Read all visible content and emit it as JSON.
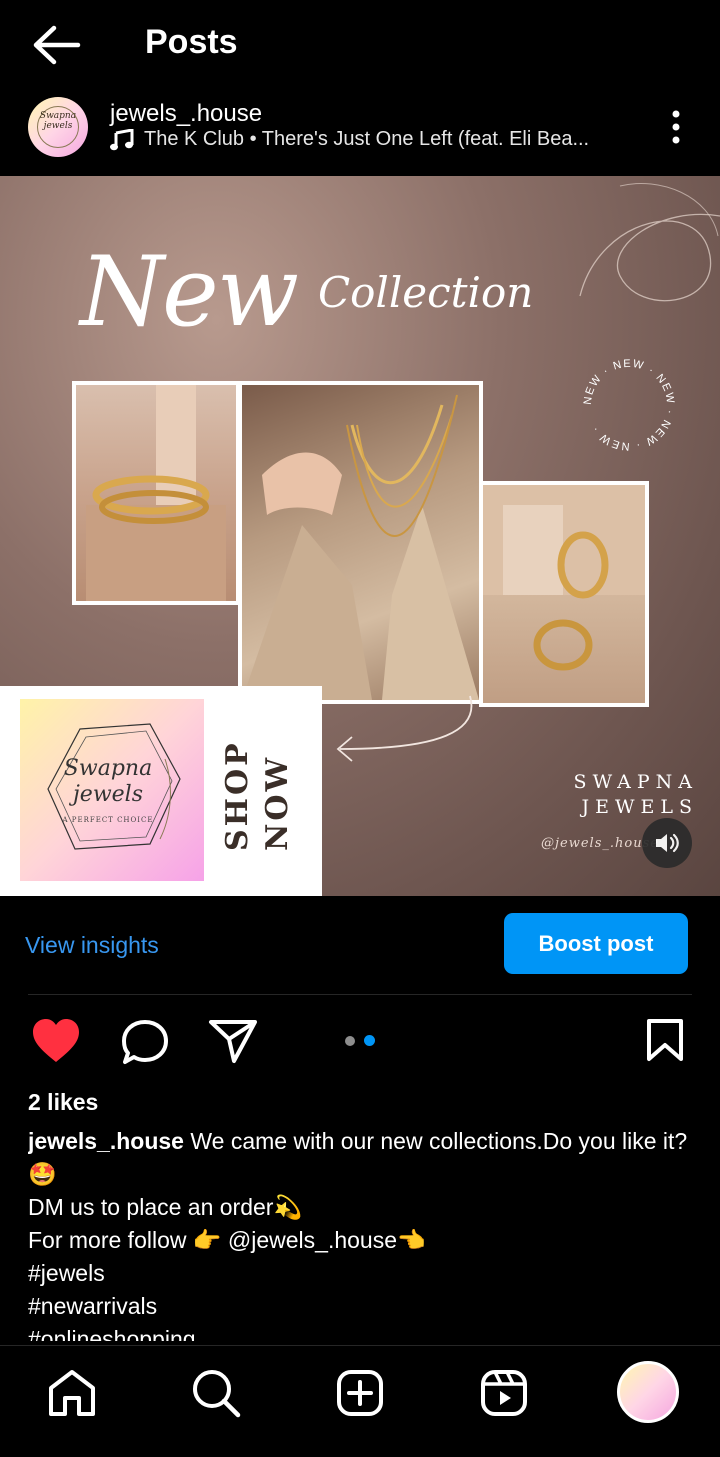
{
  "header": {
    "title": "Posts"
  },
  "post": {
    "username": "jewels_.house",
    "audio": "The K Club • There's Just One Left (feat. Eli Bea...",
    "avatar_text": "Swapna jewels",
    "image": {
      "headline": "New",
      "subheadline": "Collection",
      "badge_text": "NEW · NEW · NEW · NEW · NEW ·",
      "logo_script": "Swapna jewels",
      "logo_tagline": "A PERFECT CHOICE",
      "shop_now": "SHOP NOW",
      "brand_line1": "SWAPNA",
      "brand_line2": "JEWELS",
      "brand_handle": "@jewels_.house"
    }
  },
  "insights": {
    "view_label": "View insights",
    "boost_label": "Boost post"
  },
  "carousel": {
    "current": 2,
    "total": 2
  },
  "likes": "2 likes",
  "caption": {
    "user": "jewels_.house",
    "line1": " We came with our new collections.Do you like it?🤩",
    "line2": "DM us to place an order💫",
    "line3": "For more follow 👉 @jewels_.house👈",
    "line4": "#jewels",
    "line5": "#newarrivals",
    "line6": "#onlineshopping"
  },
  "colors": {
    "accent": "#0095f6",
    "link": "#3897f0",
    "like": "#ff3040",
    "background": "#000000"
  },
  "icons": {
    "back": "arrow-left-icon",
    "music": "music-note-icon",
    "more": "more-vertical-icon",
    "like": "heart-filled-icon",
    "comment": "comment-icon",
    "share": "send-icon",
    "save": "bookmark-icon",
    "home": "home-icon",
    "search": "search-icon",
    "create": "plus-square-icon",
    "reels": "reels-icon",
    "sound": "speaker-icon"
  }
}
